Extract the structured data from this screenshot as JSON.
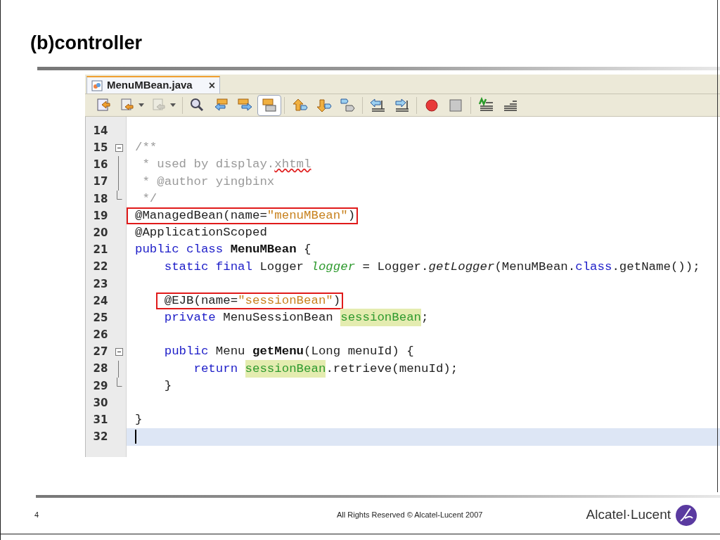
{
  "slide": {
    "title": "(b)controller",
    "page_number": "4",
    "copyright": "All Rights Reserved © Alcatel-Lucent 2007",
    "logo_text": "Alcatel·Lucent"
  },
  "editor": {
    "tab": {
      "label": "MenuMBean.java",
      "close": "×",
      "selected": true
    },
    "toolbar": [
      {
        "kind": "back",
        "selected": false,
        "disabled": false,
        "dropdown": false
      },
      {
        "kind": "history",
        "selected": false,
        "disabled": false,
        "dropdown": true
      },
      {
        "kind": "history",
        "selected": false,
        "disabled": true,
        "dropdown": true
      },
      {
        "kind": "find",
        "selected": false,
        "disabled": false,
        "dropdown": false
      },
      {
        "kind": "prev",
        "selected": false,
        "disabled": false,
        "dropdown": false
      },
      {
        "kind": "next",
        "selected": false,
        "disabled": false,
        "dropdown": false
      },
      {
        "kind": "toggle",
        "selected": true,
        "disabled": false,
        "dropdown": false
      },
      {
        "kind": "up",
        "selected": false,
        "disabled": false,
        "dropdown": false
      },
      {
        "kind": "down",
        "selected": false,
        "disabled": false,
        "dropdown": false
      },
      {
        "kind": "bookmark",
        "selected": false,
        "disabled": false,
        "dropdown": false
      },
      {
        "kind": "shiftleft",
        "selected": false,
        "disabled": false,
        "dropdown": false
      },
      {
        "kind": "shiftright",
        "selected": false,
        "disabled": false,
        "dropdown": false
      },
      {
        "kind": "record",
        "selected": false,
        "disabled": false,
        "dropdown": false
      },
      {
        "kind": "stop",
        "selected": false,
        "disabled": false,
        "dropdown": false
      },
      {
        "kind": "comment",
        "selected": false,
        "disabled": false,
        "dropdown": false
      },
      {
        "kind": "uncomment",
        "selected": false,
        "disabled": false,
        "dropdown": false
      }
    ],
    "lines": [
      {
        "number": "14",
        "kind": "plain",
        "boxed": false,
        "current": false
      },
      {
        "number": "15",
        "kind": "fold-start",
        "boxed": false,
        "current": false,
        "tokens": [
          {
            "text": "/**",
            "kind": "comment"
          }
        ]
      },
      {
        "number": "16",
        "kind": "fold-body",
        "boxed": false,
        "current": false,
        "tokens": [
          {
            "text": " * used by display.",
            "kind": "comment"
          },
          {
            "text": "xhtml",
            "kind": "misspelled"
          }
        ]
      },
      {
        "number": "17",
        "kind": "fold-body",
        "boxed": false,
        "current": false,
        "tokens": [
          {
            "text": " * @author yingbinx",
            "kind": "comment"
          }
        ]
      },
      {
        "number": "18",
        "kind": "fold-end",
        "boxed": false,
        "current": false,
        "tokens": [
          {
            "text": " */",
            "kind": "comment"
          }
        ]
      },
      {
        "number": "19",
        "kind": "plain",
        "boxed": true,
        "current": false,
        "tokens": [
          {
            "text": "@ManagedBean(name=",
            "kind": "plain"
          },
          {
            "text": "\"menuMBean\"",
            "kind": "string"
          },
          {
            "text": ")",
            "kind": "plain"
          }
        ]
      },
      {
        "number": "20",
        "kind": "plain",
        "boxed": false,
        "current": false,
        "tokens": [
          {
            "text": "@ApplicationScoped",
            "kind": "plain"
          }
        ]
      },
      {
        "number": "21",
        "kind": "plain",
        "boxed": false,
        "current": false,
        "tokens": [
          {
            "text": "public class ",
            "kind": "keyword"
          },
          {
            "text": "MenuMBean",
            "kind": "bold"
          },
          {
            "text": " {",
            "kind": "plain"
          }
        ]
      },
      {
        "number": "22",
        "kind": "plain",
        "boxed": false,
        "current": false,
        "tokens": [
          {
            "text": "    static final ",
            "kind": "keyword"
          },
          {
            "text": "Logger ",
            "kind": "plain"
          },
          {
            "text": "logger",
            "kind": "field"
          },
          {
            "text": " = Logger.",
            "kind": "plain"
          },
          {
            "text": "getLogger",
            "kind": "italic"
          },
          {
            "text": "(MenuMBean.",
            "kind": "plain"
          },
          {
            "text": "class",
            "kind": "keyword"
          },
          {
            "text": ".getName());",
            "kind": "plain"
          }
        ]
      },
      {
        "number": "23",
        "kind": "plain",
        "boxed": false,
        "current": false
      },
      {
        "number": "24",
        "kind": "plain",
        "boxed": true,
        "current": false,
        "tokens": [
          {
            "text": "    @EJB(name=",
            "kind": "plain"
          },
          {
            "text": "\"sessionBean\"",
            "kind": "string"
          },
          {
            "text": ")",
            "kind": "plain"
          }
        ]
      },
      {
        "number": "25",
        "kind": "plain",
        "boxed": false,
        "current": false,
        "tokens": [
          {
            "text": "    private ",
            "kind": "keyword"
          },
          {
            "text": "MenuSessionBean ",
            "kind": "plain"
          },
          {
            "text": "sessionBean",
            "kind": "occurrence"
          },
          {
            "text": ";",
            "kind": "plain"
          }
        ]
      },
      {
        "number": "26",
        "kind": "plain",
        "boxed": false,
        "current": false
      },
      {
        "number": "27",
        "kind": "fold-start",
        "boxed": false,
        "current": false,
        "tokens": [
          {
            "text": "    public ",
            "kind": "keyword"
          },
          {
            "text": "Menu ",
            "kind": "plain"
          },
          {
            "text": "getMenu",
            "kind": "bold"
          },
          {
            "text": "(Long menuId) {",
            "kind": "plain"
          }
        ]
      },
      {
        "number": "28",
        "kind": "fold-body",
        "boxed": false,
        "current": false,
        "tokens": [
          {
            "text": "        return ",
            "kind": "keyword"
          },
          {
            "text": "sessionBean",
            "kind": "occurrence"
          },
          {
            "text": ".retrieve(menuId);",
            "kind": "plain"
          }
        ]
      },
      {
        "number": "29",
        "kind": "fold-end",
        "boxed": false,
        "current": false,
        "tokens": [
          {
            "text": "    }",
            "kind": "plain"
          }
        ]
      },
      {
        "number": "30",
        "kind": "plain",
        "boxed": false,
        "current": false
      },
      {
        "number": "31",
        "kind": "plain",
        "boxed": false,
        "current": false,
        "tokens": [
          {
            "text": "}",
            "kind": "plain"
          }
        ]
      },
      {
        "number": "32",
        "kind": "plain",
        "boxed": false,
        "current": true
      }
    ]
  }
}
